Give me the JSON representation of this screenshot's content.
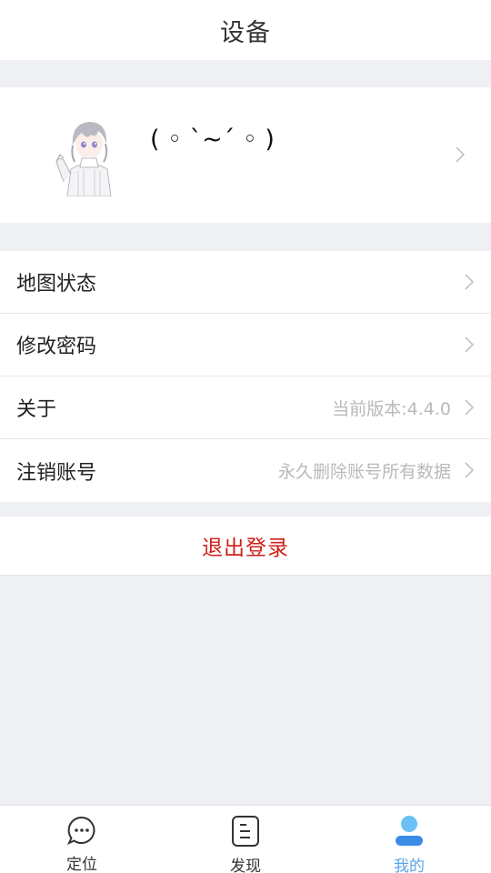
{
  "header": {
    "title": "设备"
  },
  "profile": {
    "nickname": "( ◦ ˋ~ˊ ◦ )",
    "avatar_icon": "anime-avatar-icon"
  },
  "menu": {
    "items": [
      {
        "label": "地图状态",
        "value": ""
      },
      {
        "label": "修改密码",
        "value": ""
      },
      {
        "label": "关于",
        "value": "当前版本:4.4.0"
      },
      {
        "label": "注销账号",
        "value": "永久删除账号所有数据"
      }
    ]
  },
  "logout": {
    "label": "退出登录",
    "color": "#d0201b"
  },
  "tabbar": {
    "tabs": [
      {
        "label": "定位",
        "icon": "chat-bubble-icon"
      },
      {
        "label": "发现",
        "icon": "document-icon"
      },
      {
        "label": "我的",
        "icon": "user-icon",
        "active": true
      }
    ],
    "active_color": "#5aa5e8"
  }
}
